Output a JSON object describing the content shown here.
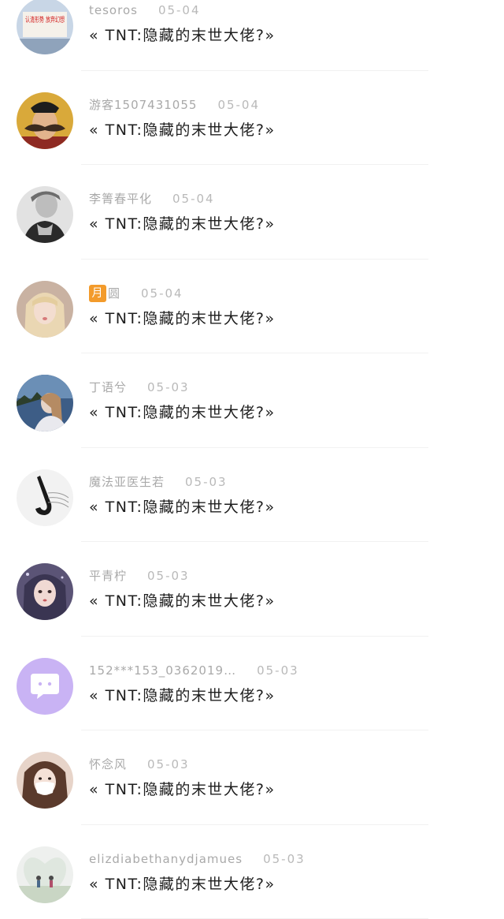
{
  "comments": [
    {
      "user": "tesoros",
      "badge": "",
      "date": "05-04",
      "text": "« TNT:隐藏的末世大佬?»",
      "avatar_icon": "banner-avatar",
      "avatar_text": "认清形势 放弃幻想"
    },
    {
      "user": "游客1507431055",
      "badge": "",
      "date": "05-04",
      "text": "« TNT:隐藏的末世大佬?»",
      "avatar_icon": "mustache-man-avatar",
      "avatar_text": ""
    },
    {
      "user": "李箐春平化",
      "badge": "",
      "date": "05-04",
      "text": "« TNT:隐藏的末世大佬?»",
      "avatar_icon": "grayscale-person-avatar",
      "avatar_text": ""
    },
    {
      "user": "圆",
      "badge": "月",
      "date": "05-04",
      "text": "« TNT:隐藏的末世大佬?»",
      "avatar_icon": "blonde-girl-avatar",
      "avatar_text": ""
    },
    {
      "user": "丁语兮",
      "badge": "",
      "date": "05-03",
      "text": "« TNT:隐藏的末世大佬?»",
      "avatar_icon": "girl-outdoor-avatar",
      "avatar_text": ""
    },
    {
      "user": "魔法亚医生若",
      "badge": "",
      "date": "05-03",
      "text": "« TNT:隐藏的末世大佬?»",
      "avatar_icon": "saxophone-avatar",
      "avatar_text": ""
    },
    {
      "user": "平青柠",
      "badge": "",
      "date": "05-03",
      "text": "« TNT:隐藏的末世大佬?»",
      "avatar_icon": "anime-girl-avatar",
      "avatar_text": ""
    },
    {
      "user": "152***153_0362019…",
      "badge": "",
      "date": "05-03",
      "text": "« TNT:隐藏的末世大佬?»",
      "avatar_icon": "chat-bubble-avatar",
      "avatar_text": ""
    },
    {
      "user": "怀念风",
      "badge": "",
      "date": "05-03",
      "text": "« TNT:隐藏的末世大佬?»",
      "avatar_icon": "masked-girl-avatar",
      "avatar_text": ""
    },
    {
      "user": "elizdiabethanydjamues",
      "badge": "",
      "date": "05-03",
      "text": "« TNT:隐藏的末世大佬?»",
      "avatar_icon": "couple-heart-avatar",
      "avatar_text": ""
    }
  ],
  "colors": {
    "username": "#a9a9a9",
    "date": "#b9b9b9",
    "message": "#1e1e1e",
    "badge": "#f39b2b",
    "divider": "#f1f1f1",
    "chat_avatar_bg": "#c9b3f4"
  }
}
